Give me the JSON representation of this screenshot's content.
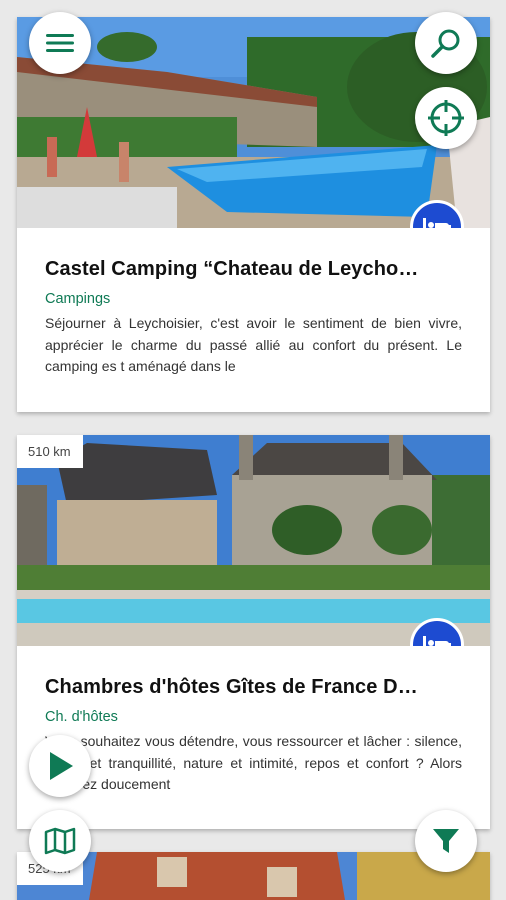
{
  "listings": [
    {
      "title": "Castel Camping “Chateau de Leycho…",
      "category": "Campings",
      "description": "Séjourner à Leychoisier, c'est avoir le sentiment de bien vivre, apprécier le charme du passé allié au confort du présent. Le camping es t aménagé dans le",
      "badge_icon": "bed-icon"
    },
    {
      "distance": "510 km",
      "title": "Chambres d'hôtes Gîtes de France D…",
      "category": "Ch. d'hôtes",
      "description": "Vous souhaitez vous détendre, vous ressourcer et lâcher : silence, calme et tranquillité, nature et intimité, repos et confort ? Alors poussez doucement",
      "badge_icon": "bed-icon"
    },
    {
      "distance": "525 km"
    }
  ],
  "controls": {
    "menu_icon": "menu-icon",
    "search_icon": "search-icon",
    "locate_icon": "crosshair-icon",
    "play_icon": "play-icon",
    "map_icon": "map-icon",
    "filter_icon": "filter-icon"
  },
  "colors": {
    "accent_green": "#0f7a55",
    "badge_blue": "#1d4bd1"
  }
}
